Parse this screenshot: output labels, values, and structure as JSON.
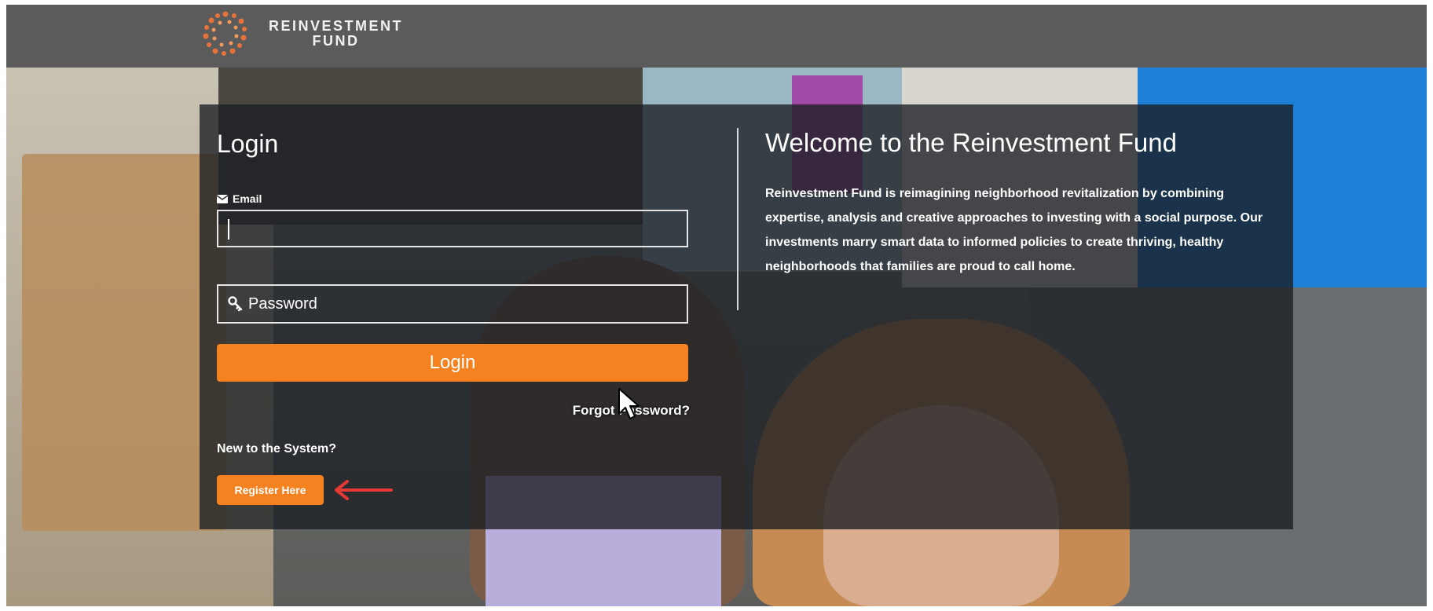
{
  "header": {
    "logo_line1": "REINVESTMENT",
    "logo_line2": "FUND",
    "brand_color": "#f58220"
  },
  "login": {
    "title": "Login",
    "email_label": "Email",
    "email_value": "",
    "password_placeholder": "Password",
    "login_button": "Login",
    "forgot_password": "Forgot Password?",
    "new_to_system": "New to the System?",
    "register_button": "Register Here"
  },
  "welcome": {
    "title": "Welcome to the Reinvestment Fund",
    "body": "Reinvestment Fund is reimagining neighborhood revitalization by combining expertise, analysis and creative approaches to investing with a social purpose. Our investments marry smart data to informed policies to create thriving, healthy neighborhoods that families are proud to call home."
  },
  "annotations": {
    "arrow_color": "#e53935"
  }
}
